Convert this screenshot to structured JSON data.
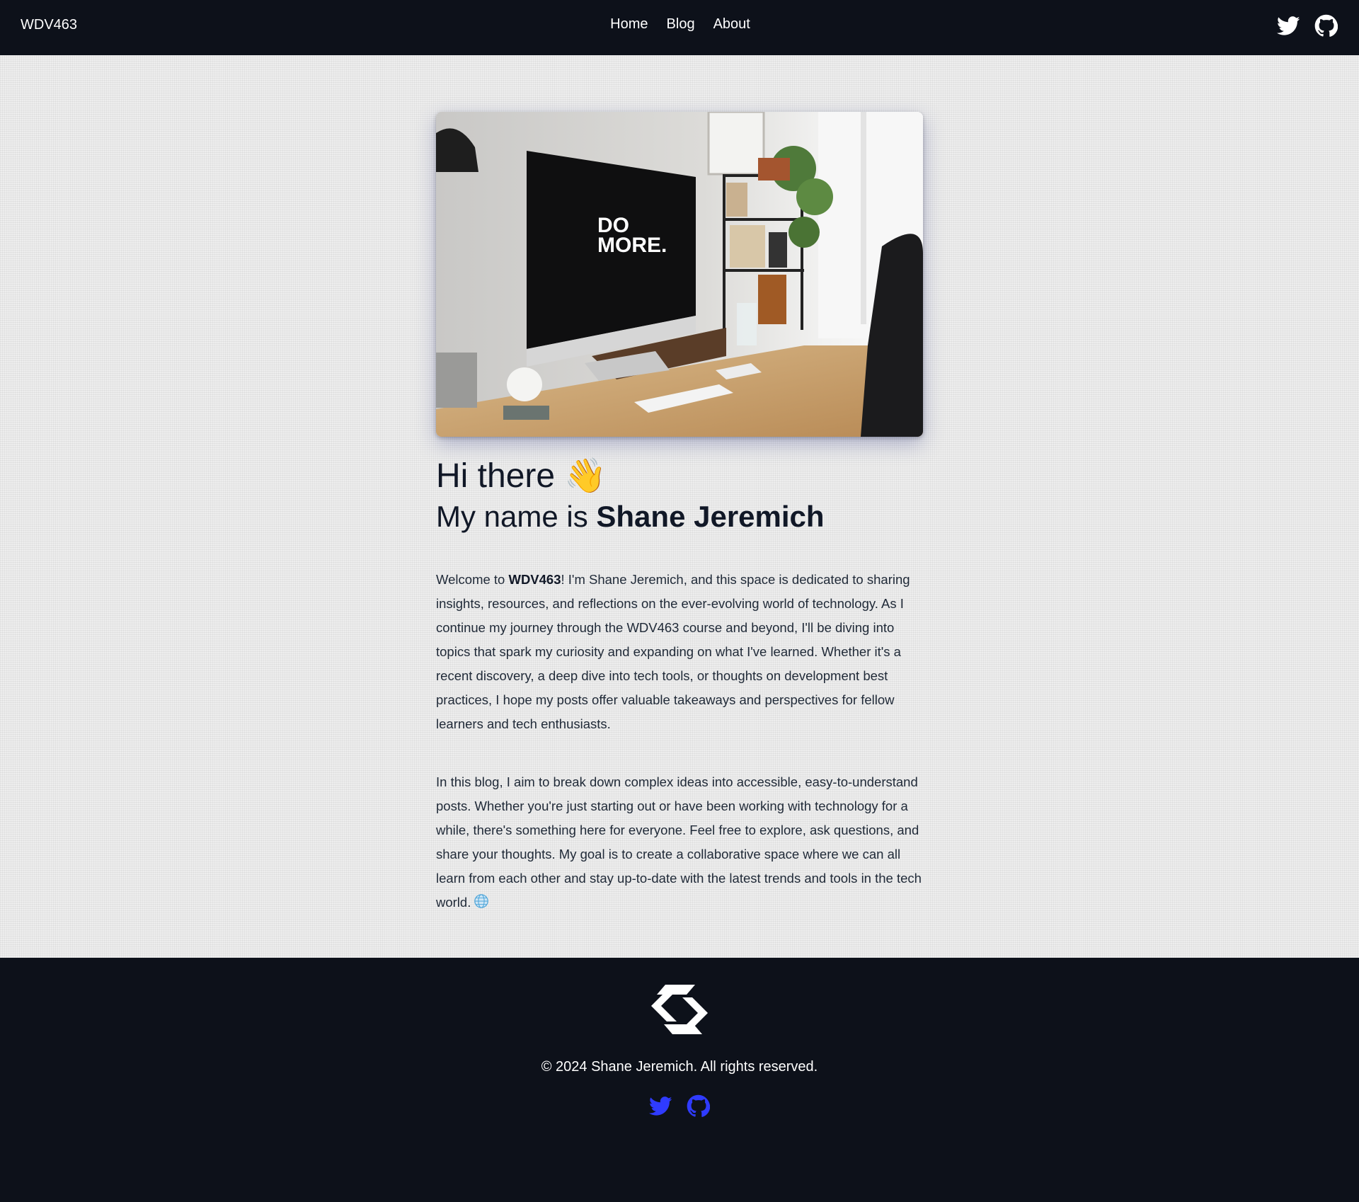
{
  "header": {
    "brand": "WDV463",
    "nav": [
      {
        "label": "Home"
      },
      {
        "label": "Blog"
      },
      {
        "label": "About"
      }
    ],
    "social_icons": [
      "twitter-icon",
      "github-icon"
    ]
  },
  "hero": {
    "screen_text_line1": "DO",
    "screen_text_line2": "MORE."
  },
  "main": {
    "greeting": "Hi there",
    "greeting_emoji": "👋",
    "intro_prefix": "My name is ",
    "name": "Shane Jeremich",
    "p1_prefix": "Welcome to ",
    "p1_brand": "WDV463",
    "p1_rest": "! I'm Shane Jeremich, and this space is dedicated to sharing insights, resources, and reflections on the ever-evolving world of technology. As I continue my journey through the WDV463 course and beyond, I'll be diving into topics that spark my curiosity and expanding on what I've learned. Whether it's a recent discovery, a deep dive into tech tools, or thoughts on development best practices, I hope my posts offer valuable takeaways and perspectives for fellow learners and tech enthusiasts.",
    "p2": "In this blog, I aim to break down complex ideas into accessible, easy-to-understand posts. Whether you're just starting out or have been working with technology for a while, there's something here for everyone. Feel free to explore, ask questions, and share your thoughts. My goal is to create a collaborative space where we can all learn from each other and stay up-to-date with the latest trends and tools in the tech world."
  },
  "footer": {
    "copyright": "© 2024 Shane Jeremich. All rights reserved.",
    "social_icons": [
      "twitter-icon",
      "github-icon"
    ]
  },
  "colors": {
    "header_bg": "#0d111a",
    "footer_bg": "#0d111a",
    "footer_icon": "#2f3bff",
    "text": "#111827"
  }
}
